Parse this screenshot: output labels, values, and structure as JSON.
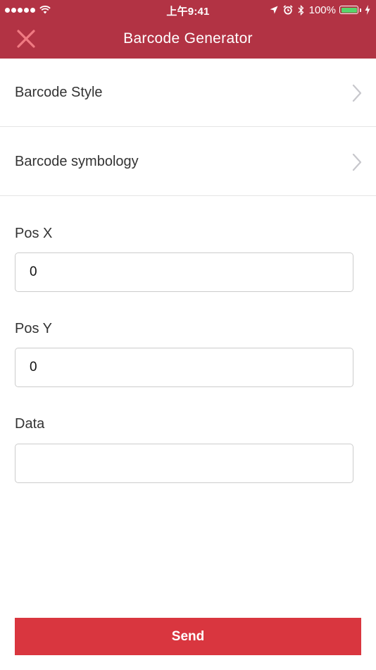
{
  "status_bar": {
    "time": "上午9:41",
    "battery_percent": "100%",
    "battery_level": 1.0,
    "icons": [
      "signal-dots-icon",
      "wifi-icon",
      "location-arrow-icon",
      "alarm-icon",
      "bluetooth-icon",
      "battery-icon",
      "charging-bolt-icon"
    ]
  },
  "nav": {
    "title": "Barcode Generator",
    "close_icon": "close-icon"
  },
  "menu": {
    "style_label": "Barcode Style",
    "symbology_label": "Barcode symbology",
    "chevron_icon": "chevron-right-icon"
  },
  "form": {
    "pos_x": {
      "label": "Pos X",
      "value": "0"
    },
    "pos_y": {
      "label": "Pos Y",
      "value": "0"
    },
    "data": {
      "label": "Data",
      "value": ""
    }
  },
  "actions": {
    "send_label": "Send"
  },
  "colors": {
    "header_bg": "#b23344",
    "close_icon": "#f07a82",
    "send_button": "#d9363f",
    "battery_fill": "#59d46b"
  }
}
